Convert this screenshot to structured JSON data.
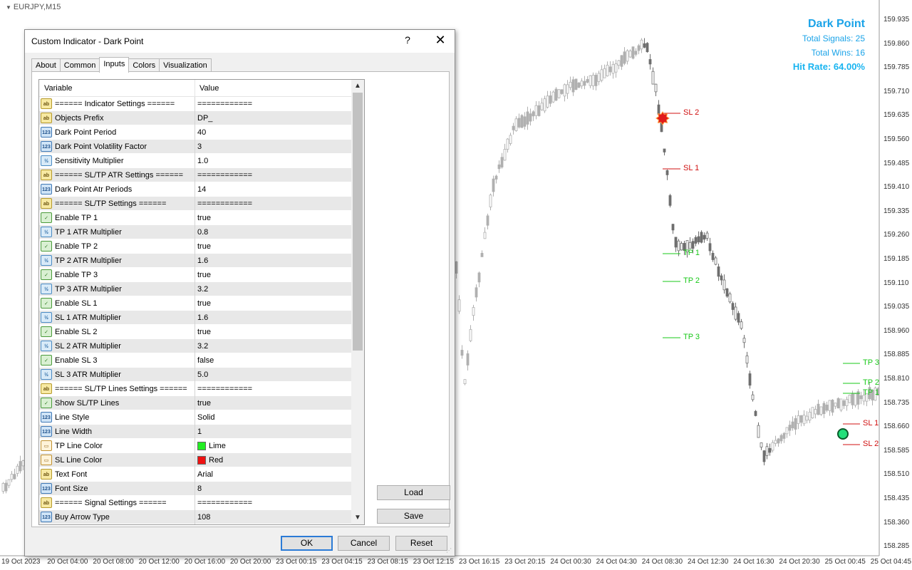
{
  "chart": {
    "symbol": "EURJPY,M15",
    "price_ticks": [
      "159.935",
      "159.860",
      "159.785",
      "159.710",
      "159.635",
      "159.560",
      "159.485",
      "159.410",
      "159.335",
      "159.260",
      "159.185",
      "159.110",
      "159.035",
      "158.960",
      "158.885",
      "158.810",
      "158.735",
      "158.660",
      "158.585",
      "158.510",
      "158.435",
      "158.360",
      "158.285"
    ],
    "time_ticks": [
      "19 Oct 2023",
      "20 Oct 04:00",
      "20 Oct 08:00",
      "20 Oct 12:00",
      "20 Oct 16:00",
      "20 Oct 20:00",
      "23 Oct 00:15",
      "23 Oct 04:15",
      "23 Oct 08:15",
      "23 Oct 12:15",
      "23 Oct 16:15",
      "23 Oct 20:15",
      "24 Oct 00:30",
      "24 Oct 04:30",
      "24 Oct 08:30",
      "24 Oct 12:30",
      "24 Oct 16:30",
      "24 Oct 20:30",
      "25 Oct 00:45",
      "25 Oct 04:45"
    ],
    "markers": [
      {
        "label": "SL 2",
        "kind": "sl"
      },
      {
        "label": "SL 1",
        "kind": "sl"
      },
      {
        "label": "TP 1",
        "kind": "tp"
      },
      {
        "label": "TP 2",
        "kind": "tp"
      },
      {
        "label": "TP 3",
        "kind": "tp"
      },
      {
        "label": "TP 3",
        "kind": "tp"
      },
      {
        "label": "TP 2",
        "kind": "tp"
      },
      {
        "label": "TP 1",
        "kind": "tp"
      },
      {
        "label": "SL 1",
        "kind": "sl"
      },
      {
        "label": "SL 2",
        "kind": "sl"
      }
    ],
    "colors": {
      "tp": "#19c819",
      "sl": "#d01010",
      "candle": "#b0b0b0",
      "candle_dark": "#6e6e6e"
    }
  },
  "stats": {
    "title": "Dark Point",
    "total_signals": "Total Signals: 25",
    "total_wins": "Total Wins: 16",
    "hit_rate": "Hit Rate: 64.00%"
  },
  "dialog": {
    "title": "Custom Indicator - Dark Point",
    "help": "?",
    "close": "✕",
    "tabs": [
      "About",
      "Common",
      "Inputs",
      "Colors",
      "Visualization"
    ],
    "active_tab": "Inputs",
    "columns": {
      "variable": "Variable",
      "value": "Value"
    },
    "rows": [
      {
        "icon": "str",
        "icon_text": "ab",
        "variable": "====== Indicator Settings ======",
        "value": "============"
      },
      {
        "icon": "str",
        "icon_text": "ab",
        "variable": "Objects Prefix",
        "value": "DP_"
      },
      {
        "icon": "int",
        "icon_text": "123",
        "variable": "Dark Point Period",
        "value": "40"
      },
      {
        "icon": "int",
        "icon_text": "123",
        "variable": "Dark Point Volatility Factor",
        "value": "3"
      },
      {
        "icon": "dbl",
        "icon_text": "½",
        "variable": "Sensitivity Multiplier",
        "value": "1.0"
      },
      {
        "icon": "str",
        "icon_text": "ab",
        "variable": "====== SL/TP ATR Settings ======",
        "value": "============"
      },
      {
        "icon": "int",
        "icon_text": "123",
        "variable": "Dark Point Atr Periods",
        "value": "14"
      },
      {
        "icon": "str",
        "icon_text": "ab",
        "variable": "====== SL/TP Settings ======",
        "value": "============"
      },
      {
        "icon": "bool",
        "icon_text": "✓",
        "variable": "Enable TP 1",
        "value": "true"
      },
      {
        "icon": "dbl",
        "icon_text": "½",
        "variable": "TP 1 ATR Multiplier",
        "value": "0.8"
      },
      {
        "icon": "bool",
        "icon_text": "✓",
        "variable": "Enable TP 2",
        "value": "true"
      },
      {
        "icon": "dbl",
        "icon_text": "½",
        "variable": "TP 2 ATR Multiplier",
        "value": "1.6"
      },
      {
        "icon": "bool",
        "icon_text": "✓",
        "variable": "Enable TP 3",
        "value": "true"
      },
      {
        "icon": "dbl",
        "icon_text": "½",
        "variable": "TP 3 ATR Multiplier",
        "value": "3.2"
      },
      {
        "icon": "bool",
        "icon_text": "✓",
        "variable": "Enable SL 1",
        "value": "true"
      },
      {
        "icon": "dbl",
        "icon_text": "½",
        "variable": "SL 1 ATR Multiplier",
        "value": "1.6"
      },
      {
        "icon": "bool",
        "icon_text": "✓",
        "variable": "Enable SL 2",
        "value": "true"
      },
      {
        "icon": "dbl",
        "icon_text": "½",
        "variable": "SL 2 ATR Multiplier",
        "value": "3.2"
      },
      {
        "icon": "bool",
        "icon_text": "✓",
        "variable": "Enable SL 3",
        "value": "false"
      },
      {
        "icon": "dbl",
        "icon_text": "½",
        "variable": "SL 3 ATR Multiplier",
        "value": "5.0"
      },
      {
        "icon": "str",
        "icon_text": "ab",
        "variable": "====== SL/TP Lines Settings ======",
        "value": "============"
      },
      {
        "icon": "bool",
        "icon_text": "✓",
        "variable": "Show SL/TP Lines",
        "value": "true"
      },
      {
        "icon": "int",
        "icon_text": "123",
        "variable": "Line Style",
        "value": "Solid"
      },
      {
        "icon": "int",
        "icon_text": "123",
        "variable": "Line Width",
        "value": "1"
      },
      {
        "icon": "clr",
        "icon_text": "▭",
        "variable": "TP Line Color",
        "value": "Lime",
        "swatch": "#22ee22"
      },
      {
        "icon": "clr",
        "icon_text": "▭",
        "variable": "SL Line Color",
        "value": "Red",
        "swatch": "#ee1111"
      },
      {
        "icon": "str",
        "icon_text": "ab",
        "variable": "Text Font",
        "value": "Arial"
      },
      {
        "icon": "int",
        "icon_text": "123",
        "variable": "Font Size",
        "value": "8"
      },
      {
        "icon": "str",
        "icon_text": "ab",
        "variable": "====== Signal Settings ======",
        "value": "============"
      },
      {
        "icon": "int",
        "icon_text": "123",
        "variable": "Buy Arrow Type",
        "value": "108"
      }
    ],
    "buttons": {
      "load": "Load",
      "save": "Save",
      "ok": "OK",
      "cancel": "Cancel",
      "reset": "Reset"
    }
  }
}
